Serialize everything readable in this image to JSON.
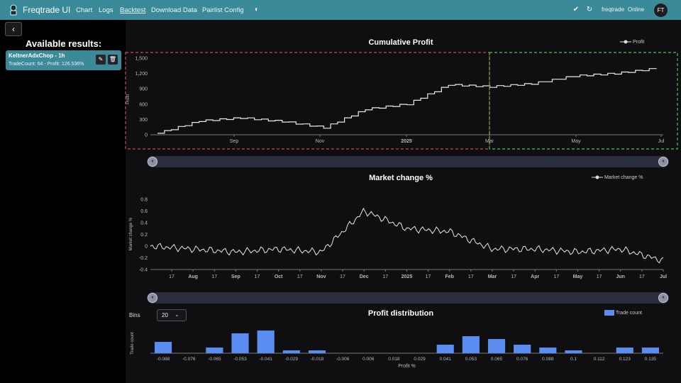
{
  "app": {
    "title": "Freqtrade UI"
  },
  "nav": [
    {
      "label": "Chart"
    },
    {
      "label": "Logs"
    },
    {
      "label": "Backtest"
    },
    {
      "label": "Download Data"
    },
    {
      "label": "Pairlist Config"
    }
  ],
  "topbar": {
    "user": "freqtrade",
    "status": "Online",
    "avatar": "FT"
  },
  "sidebar": {
    "heading": "Available results:",
    "result": {
      "name": "KeltnerAdxChop - 1h",
      "meta": "TradeCount: 64 - Profit: 126.536%"
    }
  },
  "bins": {
    "label": "Bins",
    "value": "20"
  },
  "colors": {
    "accent": "#3b8a9a",
    "bars": "#5b8df0",
    "red_box": "#c94a4a",
    "green_box": "#4ec24e"
  },
  "chart_data": [
    {
      "type": "line",
      "title": "Cumulative Profit",
      "ylabel": "Profit",
      "ylim": [
        0,
        1500
      ],
      "yticks": [
        "0",
        "300",
        "600",
        "900",
        "1,200",
        "1,500"
      ],
      "xticks": [
        "Sep",
        "Nov",
        "2025",
        "Mar",
        "May",
        "Jul"
      ],
      "series": [
        {
          "name": "Profit",
          "x": [
            "Jul",
            "Aug",
            "Sep",
            "Oct",
            "Nov",
            "Dec",
            "2025",
            "Feb",
            "Mar",
            "Apr",
            "May",
            "Jun",
            "Jul"
          ],
          "values": [
            30,
            270,
            330,
            260,
            140,
            500,
            600,
            980,
            940,
            1000,
            1150,
            1200,
            1300
          ]
        }
      ]
    },
    {
      "type": "line",
      "title": "Market change %",
      "ylabel": "Market change %",
      "ylim": [
        -0.4,
        0.8
      ],
      "yticks": [
        "-0.4",
        "-0.2",
        "0",
        "0.2",
        "0.4",
        "0.6",
        "0.8"
      ],
      "xticks": [
        "17",
        "Aug",
        "17",
        "Sep",
        "17",
        "Oct",
        "17",
        "Nov",
        "17",
        "Dec",
        "17",
        "2025",
        "17",
        "Feb",
        "17",
        "Mar",
        "17",
        "Apr",
        "17",
        "May",
        "17",
        "Jun",
        "17",
        "Jul"
      ],
      "series": [
        {
          "name": "Market change %",
          "x": [
            "Jul",
            "Aug",
            "Sep",
            "Oct",
            "Nov",
            "Dec",
            "2025",
            "Feb",
            "Mar",
            "Apr",
            "May",
            "Jun",
            "Jul"
          ],
          "values": [
            0,
            -0.05,
            -0.1,
            -0.05,
            -0.1,
            0.6,
            0.3,
            0.25,
            -0.05,
            -0.05,
            -0.1,
            -0.05,
            -0.25
          ]
        }
      ]
    },
    {
      "type": "bar",
      "title": "Profit distribution",
      "xlabel": "Profit %",
      "ylabel": "Trade count",
      "categories": [
        "-0.088",
        "-0.076",
        "-0.065",
        "-0.053",
        "-0.041",
        "-0.029",
        "-0.018",
        "-0.006",
        "0.006",
        "0.018",
        "0.029",
        "0.041",
        "0.053",
        "0.065",
        "0.076",
        "0.088",
        "0.1",
        "0.112",
        "0.123",
        "0.135"
      ],
      "series": [
        {
          "name": "Trade count",
          "values": [
            4,
            0,
            2,
            7,
            8,
            1,
            1,
            0,
            0,
            0,
            0,
            3,
            6,
            5,
            3,
            2,
            1,
            0,
            2,
            2
          ]
        }
      ]
    }
  ]
}
